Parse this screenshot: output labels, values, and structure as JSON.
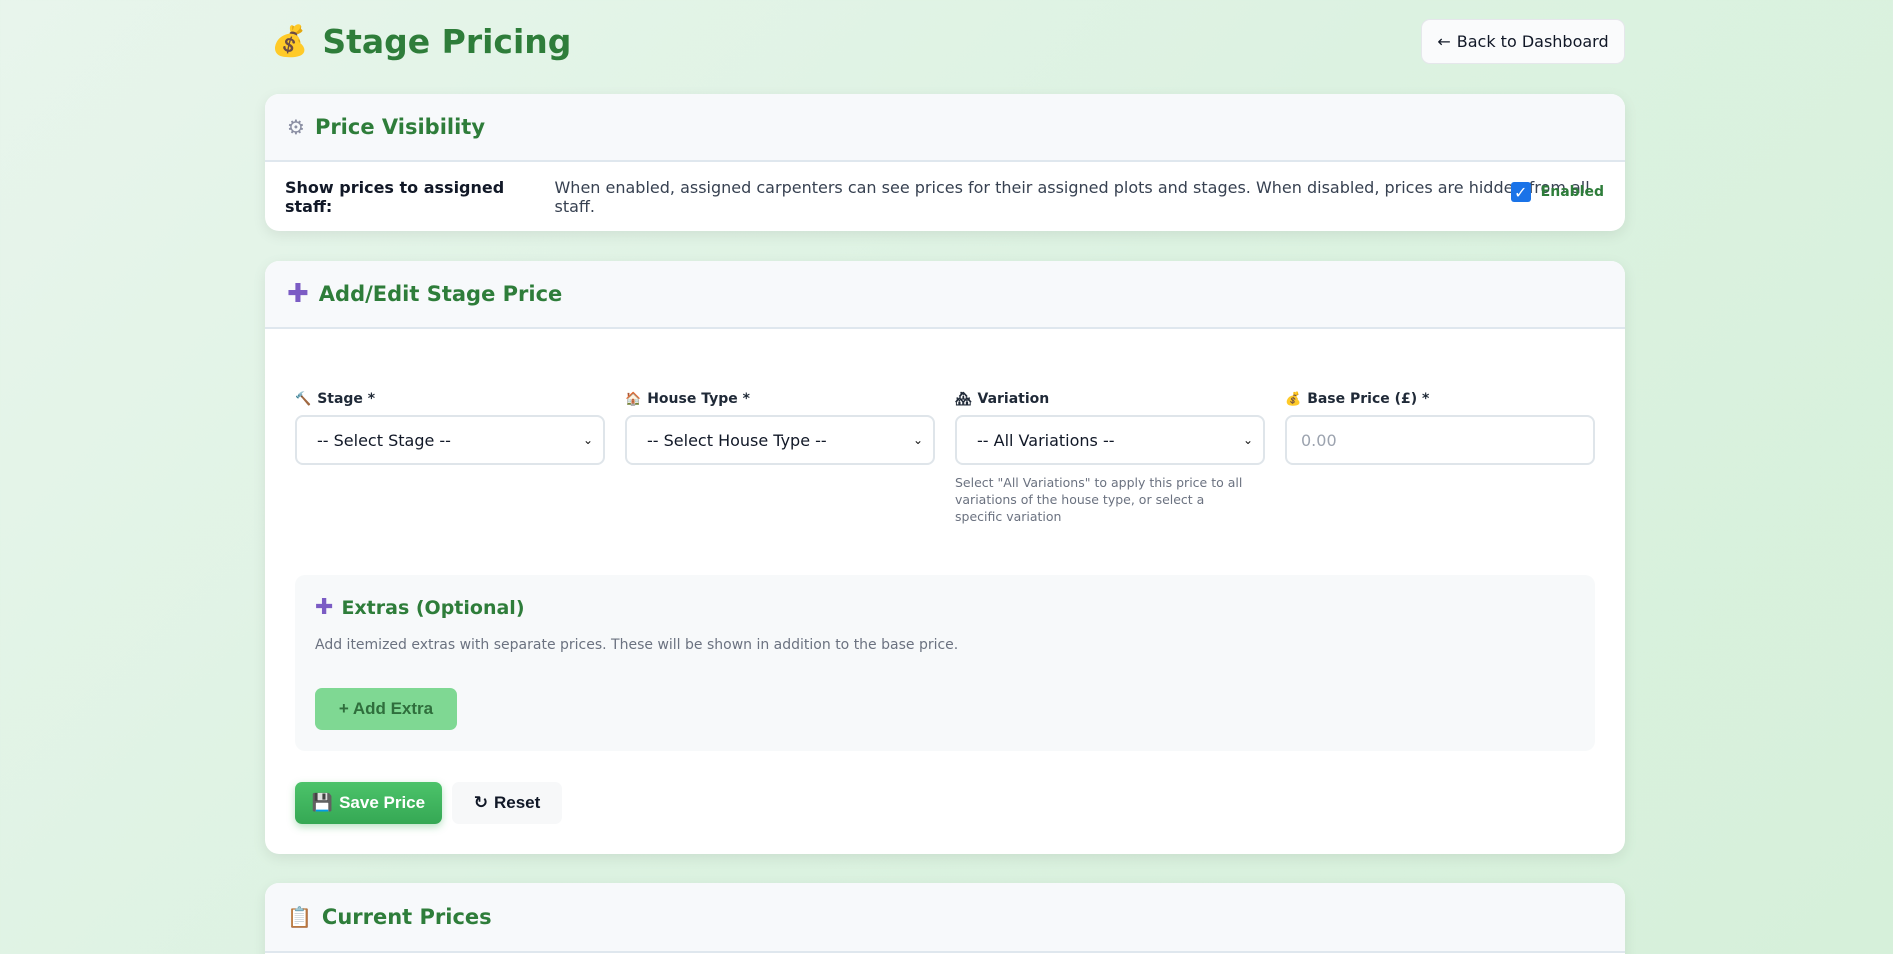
{
  "header": {
    "title": "Stage Pricing",
    "back_label": "Back to Dashboard"
  },
  "visibility": {
    "title": "Price Visibility",
    "label_bold": "Show prices to assigned staff:",
    "description": "When enabled, assigned carpenters can see prices for their assigned plots and stages. When disabled, prices are hidden from all staff.",
    "toggle_label": "Enabled",
    "checked": true
  },
  "edit": {
    "title": "Add/Edit Stage Price",
    "stage": {
      "label": "Stage *",
      "value": "-- Select Stage --"
    },
    "house_type": {
      "label": "House Type *",
      "value": "-- Select House Type --"
    },
    "variation": {
      "label": "Variation",
      "value": "-- All Variations --",
      "hint": "Select \"All Variations\" to apply this price to all variations of the house type, or select a specific variation"
    },
    "base_price": {
      "label": "Base Price (£) *",
      "placeholder": "0.00"
    },
    "extras": {
      "title": "Extras (Optional)",
      "description": "Add itemized extras with separate prices. These will be shown in addition to the base price.",
      "add_label": "Add Extra"
    },
    "save_label": "Save Price",
    "reset_label": "Reset"
  },
  "current": {
    "title": "Current Prices"
  },
  "colors": {
    "accent": "#2e7d3a",
    "purple": "#7b5cc4",
    "save": "#35a854"
  }
}
